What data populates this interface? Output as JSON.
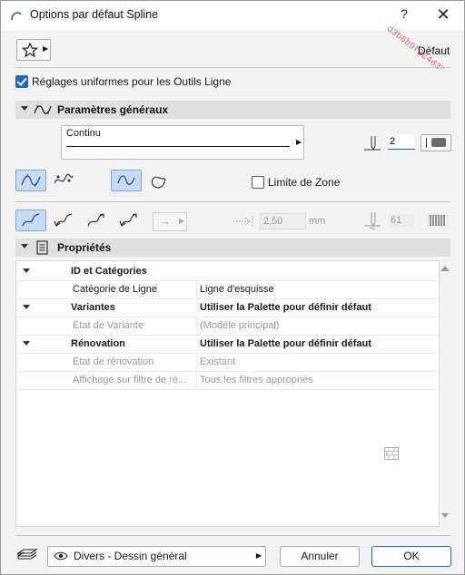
{
  "window": {
    "title": "Options par défaut Spline",
    "help_label": "?",
    "close_label": "✕",
    "watermark": "d3b6b9f3c4d3b6bfe0b8d3fb9e...a1d8d3f5c9..."
  },
  "toolbar": {
    "favorites_icon": "star-icon",
    "default_label": "Défaut"
  },
  "uniform_settings": {
    "checked": true,
    "label": "Réglages uniformes pour les Outils Ligne"
  },
  "general": {
    "title": "Paramètres généraux",
    "line_type": "Continu",
    "pen_number": "2",
    "pen_color": "#6b6b6b",
    "zone_limit_label": "Limite de Zone",
    "zone_limit_checked": false,
    "length_value": "2,50",
    "length_unit": "mm",
    "arrow_pen_value": "61"
  },
  "properties": {
    "title": "Propriétés",
    "rows": [
      {
        "kind": "group",
        "name": "ID et Catégories",
        "value": ""
      },
      {
        "kind": "item",
        "name": "Catégorie de Ligne",
        "value": "Ligne d'esquisse",
        "disabled": false
      },
      {
        "kind": "group",
        "name": "Variantes",
        "value": "Utiliser la Palette pour définir défaut"
      },
      {
        "kind": "item",
        "name": "État de Variante",
        "value": "(Modèle principal)",
        "disabled": true
      },
      {
        "kind": "group",
        "name": "Rénovation",
        "value": "Utiliser la Palette pour définir défaut"
      },
      {
        "kind": "item",
        "name": "État de rénovation",
        "value": "Existant",
        "disabled": true
      },
      {
        "kind": "item",
        "name": "Affichage sur filtre de ré...",
        "value": "Tous les filtres appropriés",
        "disabled": true
      }
    ]
  },
  "footer": {
    "layer_name": "Divers - Dessin général",
    "cancel_label": "Annuler",
    "ok_label": "OK"
  },
  "colors": {
    "accent": "#1b66c9",
    "section_bg": "#e0e0e0",
    "selected_tool_bg": "#c8dbf2"
  }
}
